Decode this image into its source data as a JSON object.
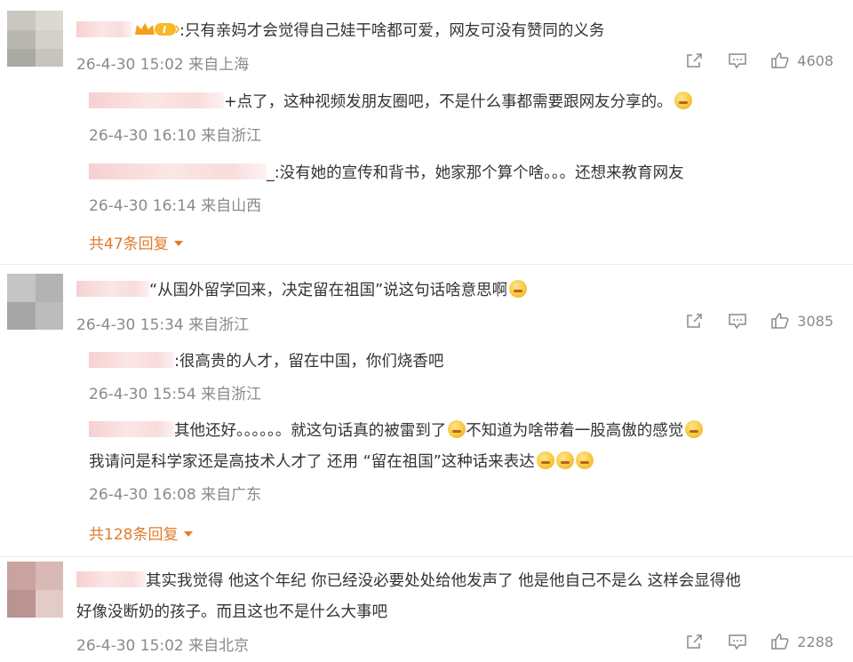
{
  "comments": [
    {
      "text": ":只有亲妈才会觉得自己娃干啥都可爱，网友可没有赞同的义务",
      "meta": "26-4-30 15:02 来自上海",
      "likes": "4608",
      "replies": [
        {
          "text": "+点了，这种视频发朋友圈吧，不是什么事都需要跟网友分享的。",
          "meta": "26-4-30 16:10 来自浙江"
        },
        {
          "text": "_:没有她的宣传和背书，她家那个算个啥。。。还想来教育网友",
          "meta": "26-4-30 16:14 来自山西"
        }
      ],
      "more_replies": "共47条回复"
    },
    {
      "text": "“从国外留学回来，决定留在祖国”说这句话啥意思啊",
      "meta": "26-4-30 15:34 来自浙江",
      "likes": "3085",
      "replies": [
        {
          "text": ":很高贵的人才，留在中国，你们烧香吧",
          "meta": "26-4-30 15:54 来自浙江"
        },
        {
          "text_line1": "其他还好。。。。。。就这句话真的被雷到了",
          "text_line1b": "不知道为啥带着一股高傲的感觉",
          "text_line2": "我请问是科学家还是高技术人才了 还用 “留在祖国”这种话来表达",
          "meta": "26-4-30 16:08 来自广东"
        }
      ],
      "more_replies": "共128条回复"
    },
    {
      "text_line1": "其实我觉得 他这个年纪 你已经没必要处处给他发声了 他是他自己不是么 这样会显得他",
      "text_line2": "好像没断奶的孩子。而且这也不是什么大事吧",
      "meta": "26-4-30 15:02 来自北京",
      "likes": "2288"
    }
  ],
  "icons": {
    "share": "share-icon",
    "comment": "comment-icon",
    "like": "like-icon",
    "emoji": "emoji-icon",
    "crown": "vip-crown-icon",
    "caret": "caret-down-icon"
  },
  "colors": {
    "accent": "#e07b2c",
    "meta": "#8a8a8a",
    "text": "#333333",
    "blur": "#f7d0d0"
  }
}
